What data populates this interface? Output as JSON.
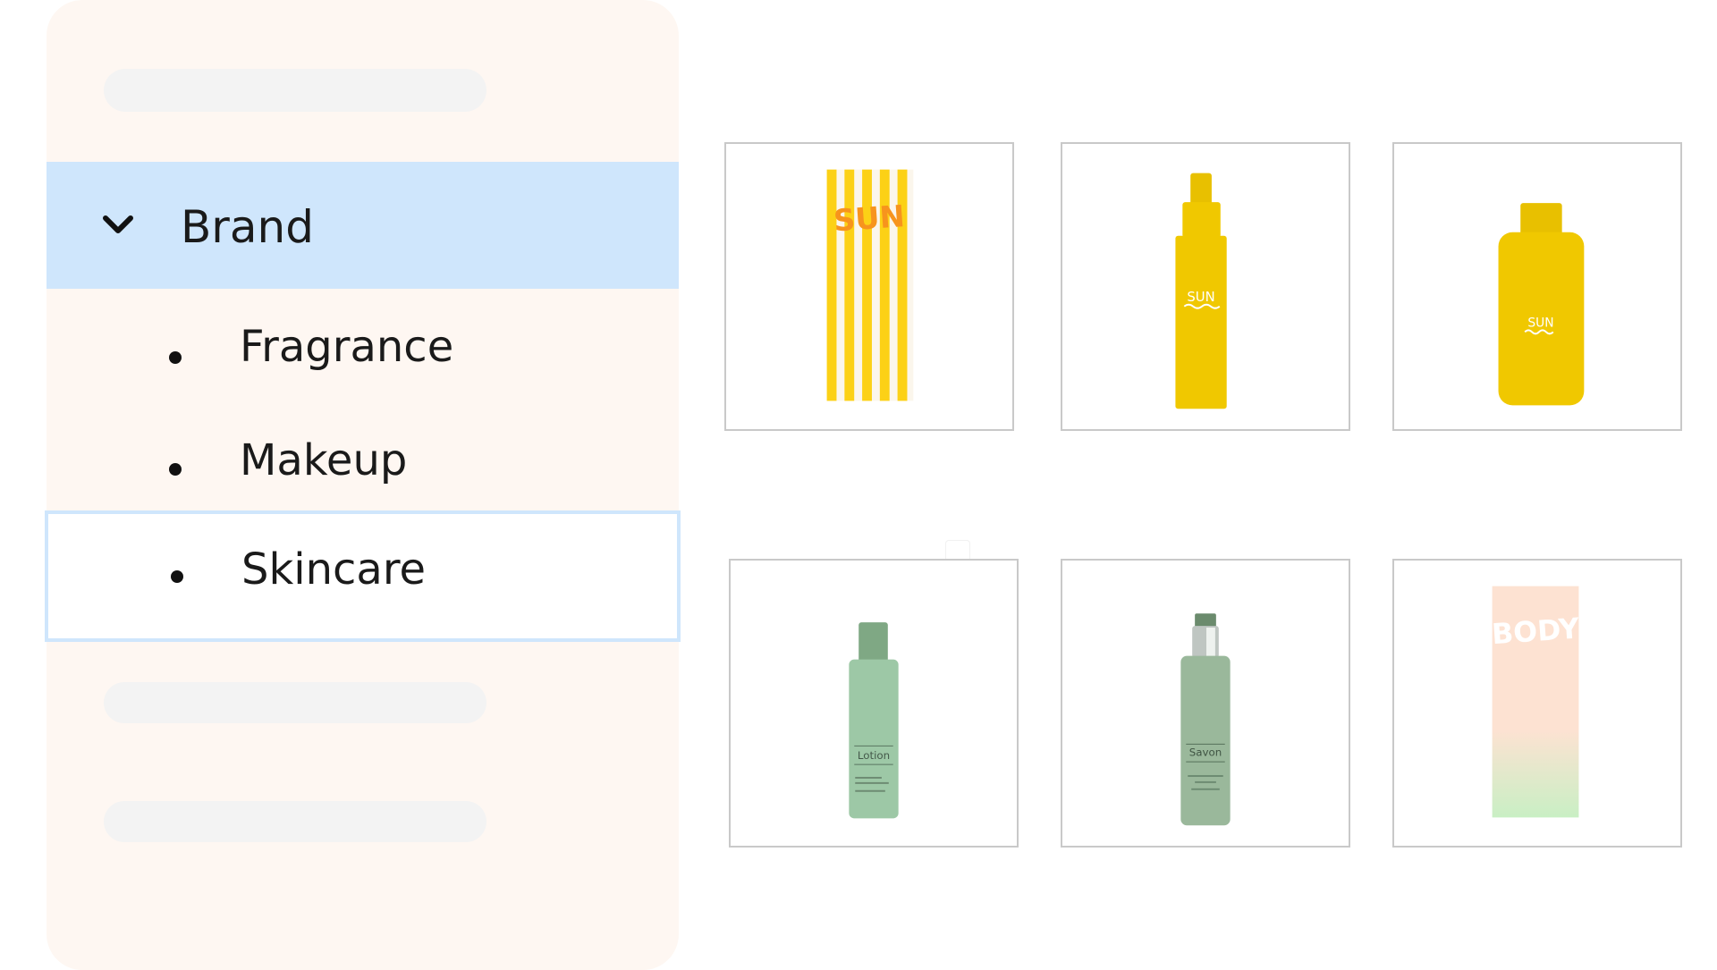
{
  "sidebar": {
    "group": {
      "label": "Brand",
      "expanded": true
    },
    "items": [
      {
        "label": "Fragrance"
      },
      {
        "label": "Makeup"
      },
      {
        "label": "Skincare",
        "selected": true
      }
    ]
  },
  "products": [
    {
      "name": "sun-towel",
      "text": "SUN",
      "colors": [
        "#fcd116",
        "#f7941d"
      ]
    },
    {
      "name": "sun-spray-bottle",
      "text": "SUN",
      "colors": [
        "#f0c800"
      ]
    },
    {
      "name": "sun-lotion-bottle",
      "text": "SUN",
      "colors": [
        "#f0c800"
      ]
    },
    {
      "name": "lotion-bottle",
      "text": "Lotion",
      "colors": [
        "#9dc8a6"
      ]
    },
    {
      "name": "savon-pump-bottle",
      "text": "Savon",
      "colors": [
        "#9ab89b"
      ]
    },
    {
      "name": "body-towel",
      "text": "BODY",
      "colors": [
        "#fde2d2",
        "#c9efc4"
      ]
    }
  ],
  "colors": {
    "accent": "#cfe6fc",
    "sidebar_bg": "#fef7f2"
  }
}
